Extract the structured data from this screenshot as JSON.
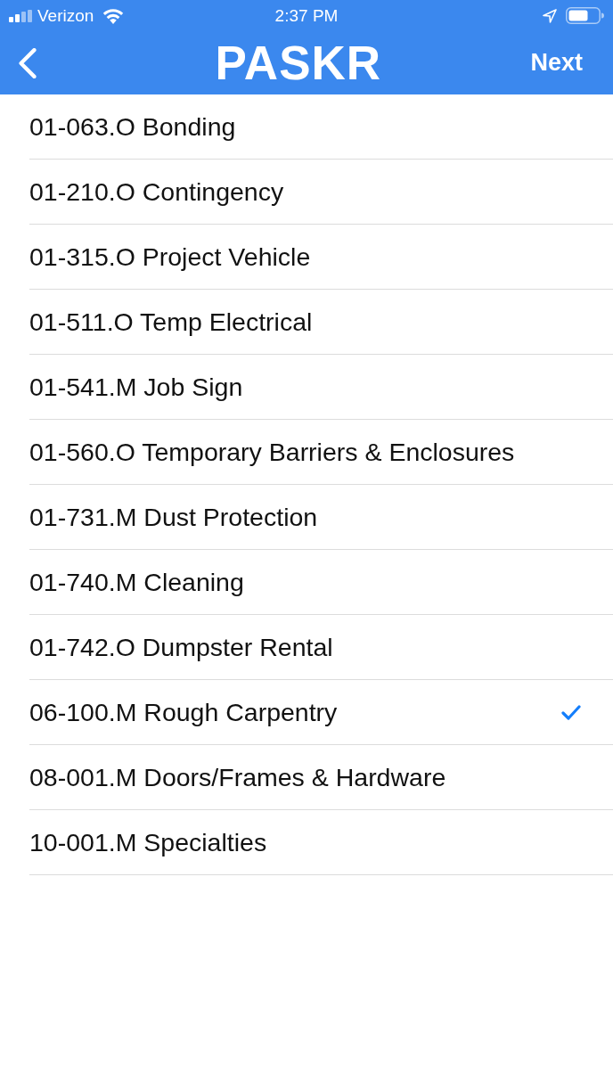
{
  "status_bar": {
    "carrier": "Verizon",
    "time": "2:37 PM"
  },
  "nav_bar": {
    "title": "PASKR",
    "next_button": "Next"
  },
  "items": [
    {
      "label": "01-063.O Bonding",
      "selected": false
    },
    {
      "label": "01-210.O Contingency",
      "selected": false
    },
    {
      "label": "01-315.O Project Vehicle",
      "selected": false
    },
    {
      "label": "01-511.O Temp Electrical",
      "selected": false
    },
    {
      "label": "01-541.M Job Sign",
      "selected": false
    },
    {
      "label": "01-560.O Temporary Barriers & Enclosures",
      "selected": false
    },
    {
      "label": "01-731.M Dust Protection",
      "selected": false
    },
    {
      "label": "01-740.M Cleaning",
      "selected": false
    },
    {
      "label": "01-742.O Dumpster Rental",
      "selected": false
    },
    {
      "label": "06-100.M Rough Carpentry",
      "selected": true
    },
    {
      "label": "08-001.M Doors/Frames & Hardware",
      "selected": false
    },
    {
      "label": "10-001.M Specialties",
      "selected": false
    }
  ]
}
